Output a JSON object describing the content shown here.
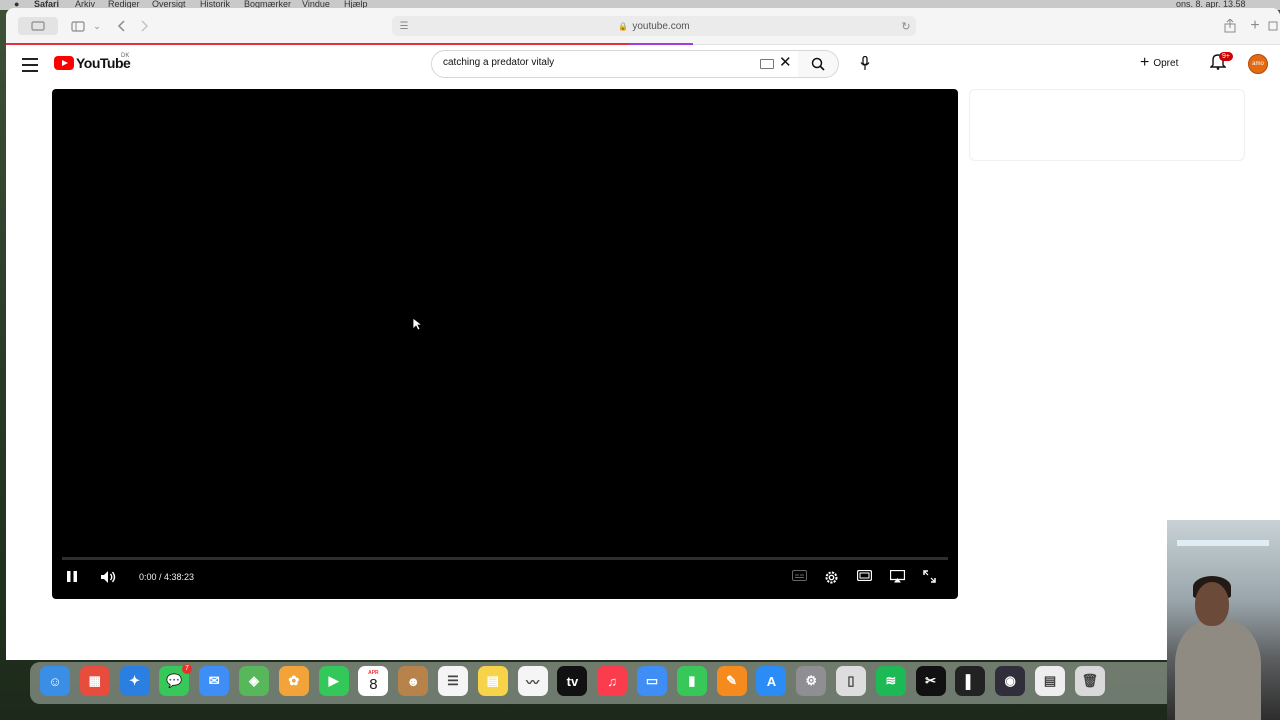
{
  "menubar": {
    "items": [
      "Safari",
      "Arkiv",
      "Rediger",
      "Oversigt",
      "Historik",
      "Bogmærker",
      "Vindue",
      "Hjælp"
    ],
    "clock": "ons. 8. apr. 13.58"
  },
  "browser": {
    "url": "youtube.com"
  },
  "youtube": {
    "logo_text": "YouTube",
    "country_code": "DK",
    "search_query": "catching a predator vitaly",
    "create_label": "Opret",
    "notification_count": "9+",
    "avatar_text": "amo"
  },
  "player": {
    "time_display": "0:00 / 4:38:23",
    "progress": 0
  },
  "dock": {
    "messages_badge": "7",
    "calendar_month": "APR",
    "calendar_day": "8",
    "apps": [
      {
        "name": "finder-icon",
        "color": "#3a8ee6",
        "glyph": "☺"
      },
      {
        "name": "launchpad-icon",
        "color": "#e84c3d",
        "glyph": "▦"
      },
      {
        "name": "safari-icon",
        "color": "#2a7fe0",
        "glyph": "✦"
      },
      {
        "name": "messages-icon",
        "color": "#38c759",
        "glyph": "💬"
      },
      {
        "name": "mail-icon",
        "color": "#3f8ef5",
        "glyph": "✉"
      },
      {
        "name": "maps-icon",
        "color": "#58b65b",
        "glyph": "◈"
      },
      {
        "name": "photos-icon",
        "color": "#f2a33a",
        "glyph": "✿"
      },
      {
        "name": "facetime-icon",
        "color": "#34c759",
        "glyph": "▶"
      },
      {
        "name": "calendar-icon",
        "color": "#ffffff",
        "glyph": ""
      },
      {
        "name": "contacts-icon",
        "color": "#b8834a",
        "glyph": "☻"
      },
      {
        "name": "reminders-icon",
        "color": "#f5f5f5",
        "glyph": "☰"
      },
      {
        "name": "notes-icon",
        "color": "#f7d34a",
        "glyph": "▤"
      },
      {
        "name": "freeform-icon",
        "color": "#f5f5f5",
        "glyph": "〰"
      },
      {
        "name": "appletv-icon",
        "color": "#111111",
        "glyph": "tv"
      },
      {
        "name": "music-icon",
        "color": "#fa3c4c",
        "glyph": "♫"
      },
      {
        "name": "keynote-icon",
        "color": "#3f8ef5",
        "glyph": "▭"
      },
      {
        "name": "numbers-icon",
        "color": "#38c759",
        "glyph": "▮"
      },
      {
        "name": "pages-icon",
        "color": "#f58a1f",
        "glyph": "✎"
      },
      {
        "name": "appstore-icon",
        "color": "#2b8cf5",
        "glyph": "A"
      },
      {
        "name": "settings-icon",
        "color": "#8e8e93",
        "glyph": "⚙"
      },
      {
        "name": "iphone-mirroring-icon",
        "color": "#dddddd",
        "glyph": "▯"
      },
      {
        "name": "spotify-icon",
        "color": "#1db954",
        "glyph": "≋"
      },
      {
        "name": "capcut-icon",
        "color": "#111111",
        "glyph": "✂"
      },
      {
        "name": "stats-icon",
        "color": "#222222",
        "glyph": "▌"
      },
      {
        "name": "obs-icon",
        "color": "#302e3b",
        "glyph": "◉"
      },
      {
        "name": "downloads-icon",
        "color": "#eeeeee",
        "glyph": "▤"
      },
      {
        "name": "trash-icon",
        "color": "#d9d9d9",
        "glyph": "🗑"
      }
    ]
  },
  "colors": {
    "youtube_red": "#ff0000",
    "player_bg": "#000000",
    "badge_red": "#cc0000",
    "loading_bar": "#e1303c"
  }
}
